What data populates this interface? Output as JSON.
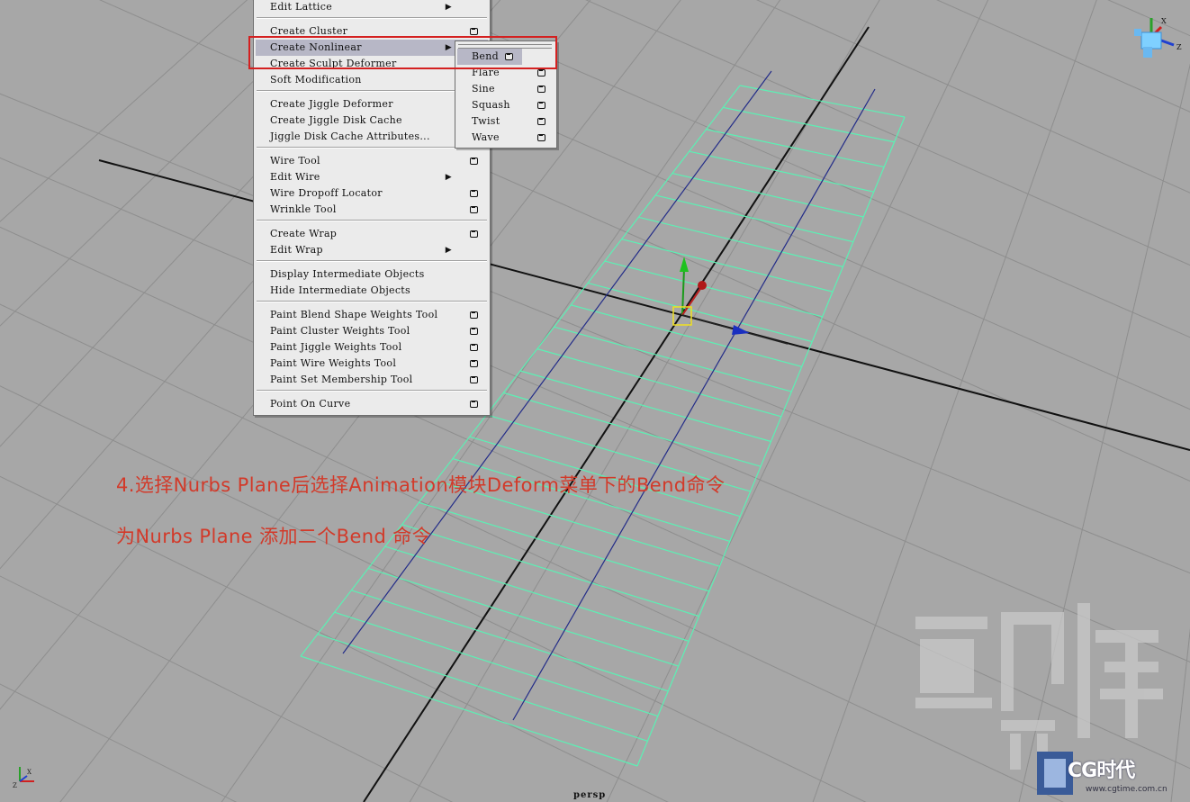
{
  "deform_menu": {
    "items": [
      {
        "label": "Edit Lattice",
        "submenu": true,
        "option_box": false
      },
      {
        "label": "Create Cluster",
        "submenu": false,
        "option_box": true
      },
      {
        "label": "Create Nonlinear",
        "submenu": true,
        "option_box": false,
        "highlighted": true
      },
      {
        "label": "Create Sculpt Deformer",
        "submenu": false,
        "option_box": false
      },
      {
        "label": "Soft Modification",
        "submenu": false,
        "option_box": false
      },
      {
        "label": "Create Jiggle Deformer",
        "submenu": false,
        "option_box": false
      },
      {
        "label": "Create Jiggle Disk Cache",
        "submenu": false,
        "option_box": false
      },
      {
        "label": "Jiggle Disk Cache Attributes...",
        "submenu": false,
        "option_box": false
      },
      {
        "label": "Wire Tool",
        "submenu": false,
        "option_box": true
      },
      {
        "label": "Edit Wire",
        "submenu": true,
        "option_box": false
      },
      {
        "label": "Wire Dropoff Locator",
        "submenu": false,
        "option_box": true
      },
      {
        "label": "Wrinkle Tool",
        "submenu": false,
        "option_box": true
      },
      {
        "label": "Create Wrap",
        "submenu": false,
        "option_box": true
      },
      {
        "label": "Edit Wrap",
        "submenu": true,
        "option_box": false
      },
      {
        "label": "Display Intermediate Objects",
        "submenu": false,
        "option_box": false
      },
      {
        "label": "Hide Intermediate Objects",
        "submenu": false,
        "option_box": false
      },
      {
        "label": "Paint Blend Shape Weights Tool",
        "submenu": false,
        "option_box": true
      },
      {
        "label": "Paint Cluster Weights Tool",
        "submenu": false,
        "option_box": true
      },
      {
        "label": "Paint Jiggle Weights Tool",
        "submenu": false,
        "option_box": true
      },
      {
        "label": "Paint Wire Weights Tool",
        "submenu": false,
        "option_box": true
      },
      {
        "label": "Paint Set Membership Tool",
        "submenu": false,
        "option_box": true
      },
      {
        "label": "Point On Curve",
        "submenu": false,
        "option_box": true
      }
    ]
  },
  "nonlinear_submenu": {
    "items": [
      {
        "label": "Bend",
        "highlighted": true
      },
      {
        "label": "Flare"
      },
      {
        "label": "Sine"
      },
      {
        "label": "Squash"
      },
      {
        "label": "Twist"
      },
      {
        "label": "Wave"
      }
    ]
  },
  "captions": {
    "line1": "4.选择Nurbs Plane后选择Animation模块Deform菜单下的Bend命令",
    "line2": "为Nurbs Plane 添加二个Bend 命令"
  },
  "viewport": {
    "camera_label": "persp",
    "background_color": "#a7a7a7",
    "grid_color": "#8d8d8d",
    "plane_color": "#5cf0b4",
    "curve_color": "#232c88",
    "highlight_color": "#d42020"
  },
  "watermark": {
    "logo_text": "CG时代",
    "site_url": "www.cgtime.com.cn"
  }
}
